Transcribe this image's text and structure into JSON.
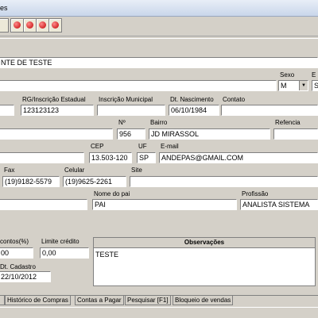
{
  "window": {
    "title": "es"
  },
  "toolbar": {
    "buttons": [
      {
        "icon": "page-icon"
      },
      {
        "icon": "first-record-icon",
        "glyph": "◀◀"
      },
      {
        "icon": "prev-record-icon",
        "glyph": "◀"
      },
      {
        "icon": "next-record-icon",
        "glyph": "▶"
      },
      {
        "icon": "last-record-icon",
        "glyph": "▶▶"
      }
    ]
  },
  "form": {
    "nome": "NTE DE TESTE",
    "sexo_label": "Sexo",
    "sexo_value": "M",
    "estado_civil_label": "E",
    "estado_civil_value": "S",
    "rg_label": "RG/Inscrição Estadual",
    "rg_value": "123123123",
    "inscricao_municipal_label": "Inscrição Municipal",
    "inscricao_municipal_value": "",
    "dt_nascimento_label": "Dt. Nascimento",
    "dt_nascimento_value": "06/10/1984",
    "contato_label": "Contato",
    "contato_value": "",
    "numero_label": "Nº",
    "numero_value": "956",
    "bairro_label": "Bairro",
    "bairro_value": "JD MIRASSOL",
    "referencia_label": "Refencia",
    "referencia_value": "",
    "cep_label": "CEP",
    "cep_value": "13.503-120",
    "uf_label": "UF",
    "uf_value": "SP",
    "email_label": "E-mail",
    "email_value": "ANDEPAS@GMAIL.COM",
    "fax_label": "Fax",
    "fax_value": "(19)9182-5579",
    "celular_label": "Celular",
    "celular_value": "(19)9625-2261",
    "site_label": "Site",
    "site_value": "",
    "nome_pai_label": "Nome do pai",
    "nome_pai_value": "PAI",
    "profissao_label": "Profissão",
    "profissao_value": "ANALISTA SISTEMA",
    "descontos_label": "contos(%)",
    "descontos_value": "00",
    "limite_credito_label": "Limite crédito",
    "limite_credito_value": "0,00",
    "dt_cadastro_label": "Dt. Cadastro",
    "dt_cadastro_value": "22/10/2012",
    "observacoes_label": "Observações",
    "observacoes_value": "TESTE"
  },
  "tabs": [
    {
      "label": "Histórico de Compras"
    },
    {
      "label": "Contas a Pagar"
    },
    {
      "label": "Pesquisar [F1]"
    },
    {
      "label": "Bloqueio de vendas"
    }
  ]
}
